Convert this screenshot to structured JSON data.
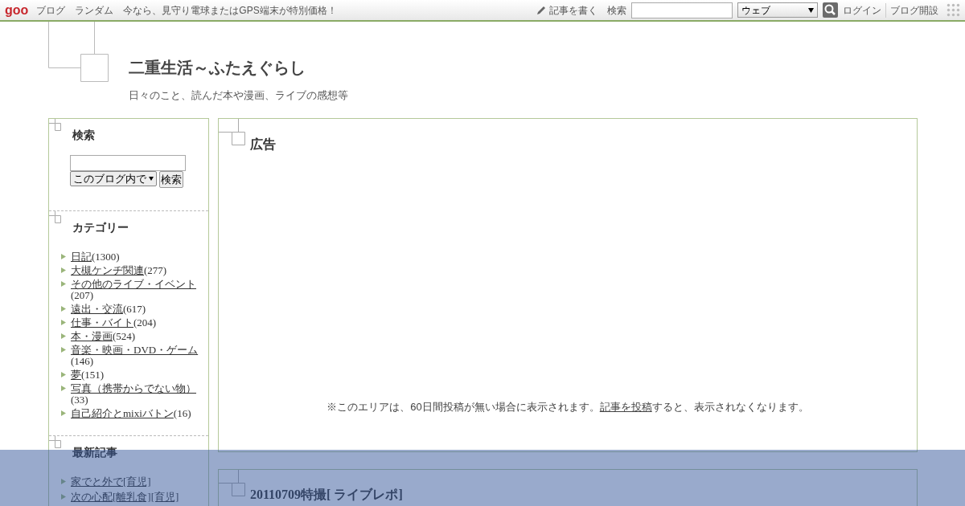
{
  "toolbar": {
    "logo": "goo",
    "links": [
      "ブログ",
      "ランダム"
    ],
    "promo": "今なら、見守り電球またはGPS端末が特別価格！",
    "write": "記事を書く",
    "search_label": "検索",
    "search_scope": "ウェブ",
    "login": "ログイン",
    "signup": "ブログ開設"
  },
  "blog": {
    "title": "二重生活～ふたえぐらし",
    "description": "日々のこと、読んだ本や漫画、ライブの感想等"
  },
  "sidebar": {
    "search": {
      "title": "検索",
      "scope": "このブログ内で",
      "button": "検索"
    },
    "categories": {
      "title": "カテゴリー",
      "items": [
        {
          "name": "日記",
          "count": "(1300)"
        },
        {
          "name": "大槻ケンヂ関連",
          "count": "(277)"
        },
        {
          "name": "その他のライブ・イベント",
          "count": "(207)"
        },
        {
          "name": "遠出・交流",
          "count": "(617)"
        },
        {
          "name": "仕事・バイト",
          "count": "(204)"
        },
        {
          "name": "本・漫画",
          "count": "(524)"
        },
        {
          "name": "音楽・映画・DVD・ゲーム",
          "count": "(146)"
        },
        {
          "name": "夢",
          "count": "(151)"
        },
        {
          "name": "写真（携帯からでない物）",
          "count": "(33)"
        },
        {
          "name": "自己紹介とmixiバトン",
          "count": "(16)"
        }
      ]
    },
    "recent": {
      "title": "最新記事",
      "items": [
        "家でと外で[育児]",
        "次の心配[離乳食][育児]"
      ]
    }
  },
  "main": {
    "ad": {
      "title": "広告",
      "notice_before": "※このエリアは、60日間投稿が無い場合に表示されます。",
      "notice_link": "記事を投稿",
      "notice_after": "すると、表示されなくなります。"
    },
    "article": {
      "title": "20110709特撮[ ライブレポ]"
    }
  }
}
